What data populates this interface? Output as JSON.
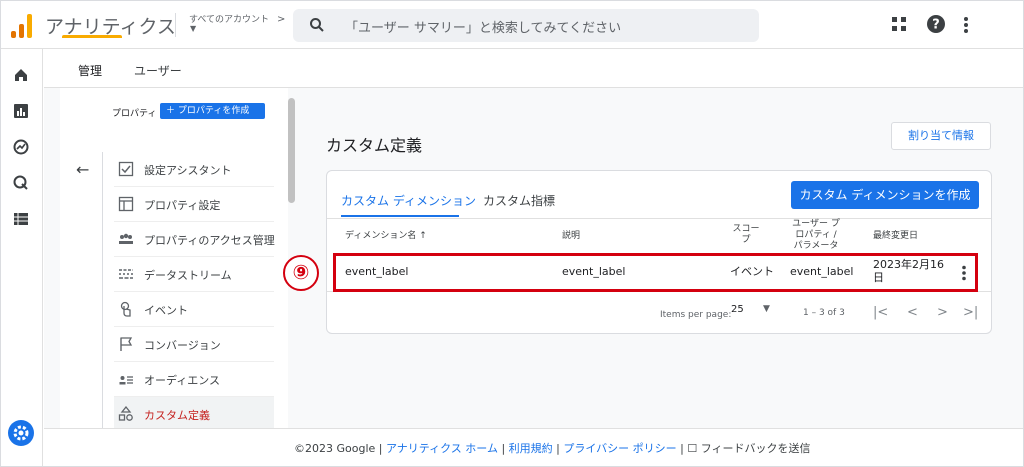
{
  "header": {
    "app_name": "アナリティクス",
    "account_label": "すべてのアカウント",
    "search_placeholder": "「ユーザー サマリー」と検索してみてください",
    "logo_colors": [
      "#f9ab00",
      "#e37400",
      "#e37400"
    ]
  },
  "rail": {
    "icons": [
      "home-icon",
      "reports-icon",
      "explore-icon",
      "advertising-icon",
      "list-icon",
      "settings-icon"
    ]
  },
  "tabs": [
    {
      "label": "管理",
      "active": true
    },
    {
      "label": "ユーザー",
      "active": false
    }
  ],
  "nav": {
    "property_label": "プロパティ",
    "create_property_label": "＋ プロパティを作成",
    "items": [
      {
        "label": "設定アシスタント",
        "icon": "checklist-icon",
        "active": false
      },
      {
        "label": "プロパティ設定",
        "icon": "window-icon",
        "active": false
      },
      {
        "label": "プロパティのアクセス管理",
        "icon": "people-icon",
        "active": false
      },
      {
        "label": "データストリーム",
        "icon": "stream-icon",
        "active": false
      },
      {
        "label": "イベント",
        "icon": "touch-icon",
        "active": false
      },
      {
        "label": "コンバージョン",
        "icon": "flag-icon",
        "active": false
      },
      {
        "label": "オーディエンス",
        "icon": "audience-icon",
        "active": false
      },
      {
        "label": "カスタム定義",
        "icon": "shapes-icon",
        "active": true
      }
    ]
  },
  "content": {
    "title": "カスタム定義",
    "assign_button": "割り当て情報",
    "card_tabs": [
      {
        "label": "カスタム ディメンション",
        "active": true
      },
      {
        "label": "カスタム指標",
        "active": false
      }
    ],
    "create_button": "カスタム ディメンションを作成",
    "table": {
      "headers": {
        "name": "ディメンション名 ↑",
        "description": "説明",
        "scope": [
          "スコー",
          "プ"
        ],
        "user_property": [
          "ユーザー プ",
          "ロパティ /",
          "パラメータ"
        ],
        "modified": "最終変更日"
      },
      "rows": [
        {
          "name": "event_label",
          "description": "event_label",
          "scope": "イベント",
          "user_property": "event_label",
          "modified": [
            "2023年2月16",
            "日"
          ]
        }
      ]
    },
    "pagination": {
      "items_per_page_label": "Items per page:",
      "items_per_page_value": "25",
      "range": "1 – 3 of 3"
    }
  },
  "annotation": {
    "badge": "⑨",
    "color": "#d4000f"
  },
  "footer": {
    "copyright": "©2023 Google",
    "links": [
      "アナリティクス ホーム",
      "利用規約",
      "プライバシー ポリシー"
    ],
    "feedback": "フィードバックを送信"
  }
}
